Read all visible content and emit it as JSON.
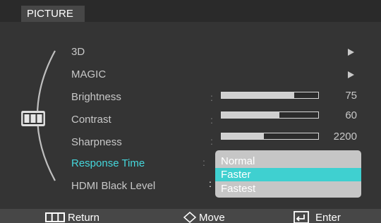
{
  "window": {
    "title": "PICTURE"
  },
  "menu": [
    {
      "label": "3D",
      "type": "submenu"
    },
    {
      "label": "MAGIC",
      "type": "submenu"
    },
    {
      "label": "Brightness",
      "type": "slider",
      "level": 75,
      "value": "75"
    },
    {
      "label": "Contrast",
      "type": "slider",
      "level": 60,
      "value": "60"
    },
    {
      "label": "Sharpness",
      "type": "slider",
      "level": 0.44,
      "value": "2200"
    },
    {
      "label": "Response Time",
      "type": "option",
      "selected": true
    },
    {
      "label": "HDMI Black Level",
      "type": "option"
    }
  ],
  "response_time_dropdown": {
    "options": [
      "Normal",
      "Faster",
      "Fastest"
    ],
    "selected": "Faster"
  },
  "footer": {
    "return_label": "Return",
    "move_label": "Move",
    "enter_label": "Enter"
  },
  "colors": {
    "background": "#343434",
    "highlight_text": "#45d7dc",
    "highlight_bar": "#3fd0d0",
    "dropdown_bg": "#c6c6c6",
    "footer_bg": "#474747"
  },
  "icons": [
    "menu-grid-icon",
    "right-arrow-icon",
    "diamond-arrows-icon",
    "enter-icon"
  ]
}
